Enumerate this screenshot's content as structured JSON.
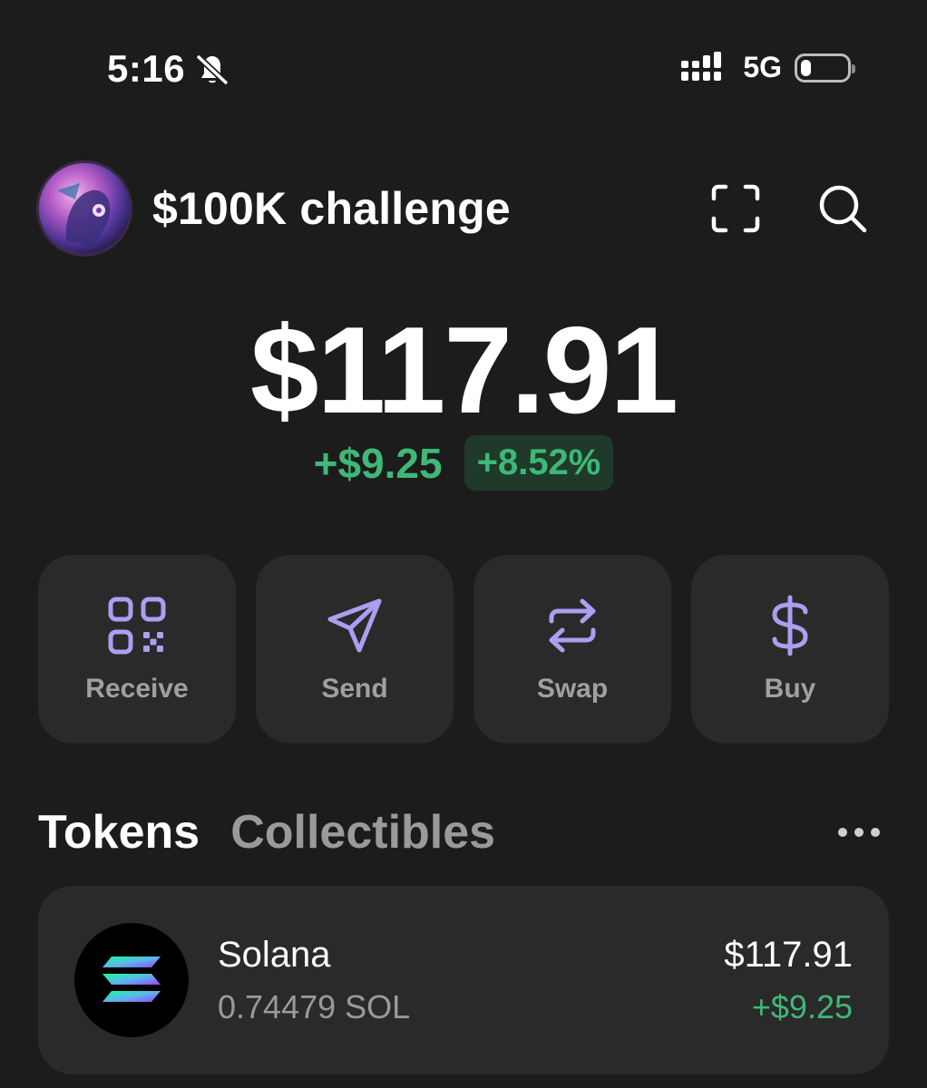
{
  "status_bar": {
    "time": "5:16",
    "silent_icon": "bell-slash-icon",
    "signal_icon": "signal-icon",
    "network": "5G",
    "battery_icon": "battery-icon",
    "battery_level": 0.22
  },
  "header": {
    "account_name": "$100K challenge",
    "avatar": "avatar",
    "scan_icon": "scan-icon",
    "search_icon": "search-icon"
  },
  "balance": {
    "total": "$117.91",
    "change_usd": "+$9.25",
    "change_pct": "+8.52%"
  },
  "actions": [
    {
      "label": "Receive",
      "icon": "qr-code-icon"
    },
    {
      "label": "Send",
      "icon": "send-icon"
    },
    {
      "label": "Swap",
      "icon": "swap-icon"
    },
    {
      "label": "Buy",
      "icon": "dollar-icon"
    }
  ],
  "tabs": {
    "tokens": "Tokens",
    "collectibles": "Collectibles",
    "more_icon": "more-horizontal-icon"
  },
  "tokens": [
    {
      "name": "Solana",
      "amount": "0.74479 SOL",
      "value": "$117.91",
      "change": "+$9.25",
      "icon": "solana-logo-icon"
    }
  ],
  "colors": {
    "background": "#1c1c1c",
    "card": "#2a2a2a",
    "accent_purple": "#ab9ff2",
    "positive_green": "#3eb877"
  }
}
